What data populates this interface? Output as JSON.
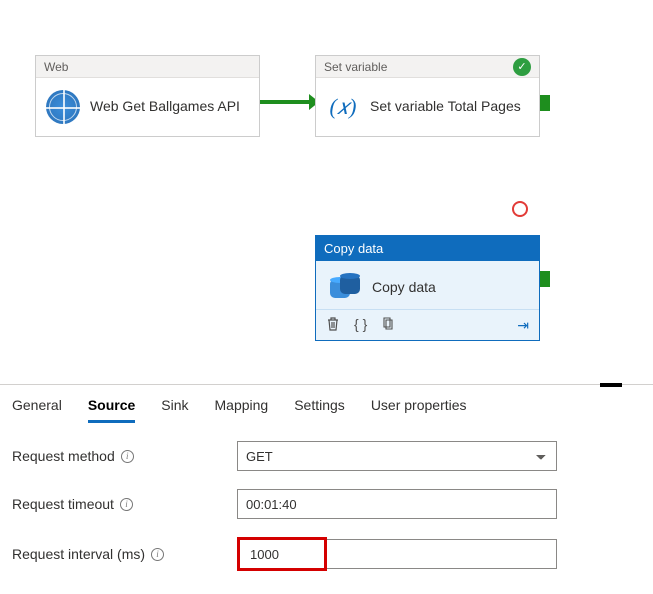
{
  "canvas": {
    "web_activity": {
      "header": "Web",
      "label": "Web Get Ballgames API"
    },
    "set_variable_activity": {
      "header": "Set variable",
      "label": "Set variable Total Pages"
    },
    "copy_activity": {
      "header": "Copy data",
      "label": "Copy data"
    },
    "var_icon_text": "(𝑥)",
    "checkmark": "✓",
    "braces_icon": "{ }",
    "arrow_icon": "⇥"
  },
  "tabs": {
    "general": "General",
    "source": "Source",
    "sink": "Sink",
    "mapping": "Mapping",
    "settings": "Settings",
    "user_properties": "User properties"
  },
  "form": {
    "request_method": {
      "label": "Request method",
      "value": "GET"
    },
    "request_timeout": {
      "label": "Request timeout",
      "value": "00:01:40"
    },
    "request_interval": {
      "label": "Request interval (ms)",
      "value": "1000"
    }
  }
}
